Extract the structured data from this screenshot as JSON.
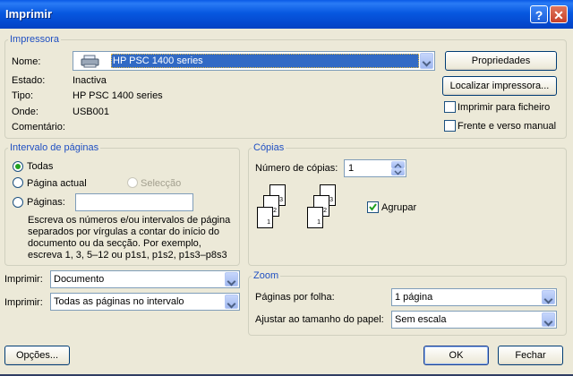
{
  "window": {
    "title": "Imprimir",
    "help": "?",
    "close": "✕"
  },
  "printer": {
    "legend": "Impressora",
    "name_label": "Nome:",
    "name_value": "HP PSC 1400 series",
    "status_label": "Estado:",
    "status_value": "Inactiva",
    "type_label": "Tipo:",
    "type_value": "HP PSC 1400 series",
    "where_label": "Onde:",
    "where_value": "USB001",
    "comment_label": "Comentário:",
    "properties_button": "Propriedades",
    "find_button": "Localizar impressora...",
    "print_to_file": "Imprimir para ficheiro",
    "print_to_file_checked": false,
    "manual_duplex": "Frente e verso manual",
    "manual_duplex_checked": false
  },
  "range": {
    "legend": "Intervalo de páginas",
    "all": "Todas",
    "current": "Página actual",
    "selection": "Selecção",
    "pages": "Páginas:",
    "pages_value": "",
    "selected": "all",
    "help": [
      "Escreva os números e/ou intervalos de página",
      "separados por vírgulas a contar do início do",
      "documento ou da secção. Por exemplo,",
      "escreva 1, 3, 5–12 ou p1s1, p1s2, p1s3–p8s3"
    ]
  },
  "copies": {
    "legend": "Cópias",
    "number_label": "Número de cópias:",
    "number_value": "1",
    "collate": "Agrupar",
    "collate_checked": true,
    "page_numbers": [
      "1",
      "2",
      "3"
    ]
  },
  "print_what": {
    "label": "Imprimir:",
    "value": "Documento"
  },
  "print_range": {
    "label": "Imprimir:",
    "value": "Todas as páginas no intervalo"
  },
  "zoom": {
    "legend": "Zoom",
    "pages_per_sheet_label": "Páginas por folha:",
    "pages_per_sheet_value": "1 página",
    "scale_label": "Ajustar ao tamanho do papel:",
    "scale_value": "Sem escala"
  },
  "buttons": {
    "options": "Opções...",
    "ok": "OK",
    "close": "Fechar"
  },
  "colors": {
    "title_bar": "#0758e0",
    "dialog_bg": "#ece9d8",
    "group_label": "#1f4fc2",
    "selection": "#316ac5"
  }
}
